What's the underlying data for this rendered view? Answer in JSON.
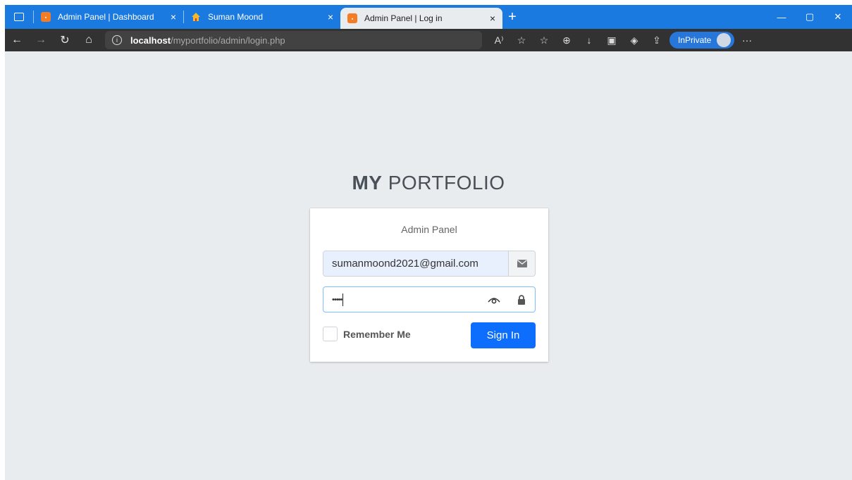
{
  "browser": {
    "tabs": [
      {
        "label": "Admin Panel | Dashboard",
        "favicon": "xampp-icon",
        "active": false
      },
      {
        "label": "Suman Moond",
        "favicon": "home-icon",
        "active": false
      },
      {
        "label": "Admin Panel | Log in",
        "favicon": "xampp-icon",
        "active": true
      }
    ],
    "new_tab_label": "+",
    "close_glyph": "×",
    "url_host": "localhost",
    "url_path": "/myportfolio/admin/login.php",
    "inprivate_label": "InPrivate",
    "more_label": "···",
    "window_controls": {
      "minimize": "—",
      "maximize": "▢",
      "close": "✕"
    }
  },
  "login": {
    "logo_bold": "MY",
    "logo_rest": " PORTFOLIO",
    "card_message": "Admin Panel",
    "email_value": "sumanmoond2021@gmail.com",
    "password_value": "•••••",
    "remember_label": "Remember Me",
    "signin_label": "Sign In"
  },
  "colors": {
    "tabbar": "#1a7ae0",
    "page_background": "#e9ecef",
    "primary_button": "#0d6efd"
  }
}
